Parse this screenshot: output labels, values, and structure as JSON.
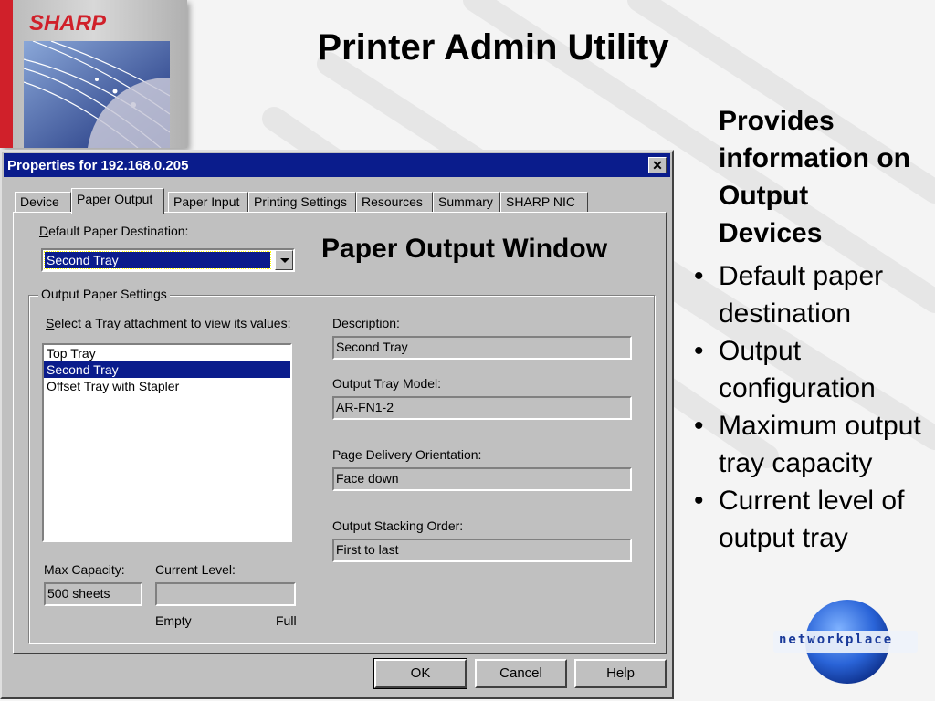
{
  "slide": {
    "title": "Printer Admin Utility",
    "side_heading": "Provides information on Output Devices",
    "bullets": [
      "Default paper destination",
      "Output configuration",
      "Maximum output tray capacity",
      "Current level of output tray"
    ],
    "panel_caption": "Paper Output Window",
    "logo_text": "SHARP",
    "np_logo_text": "networkplace"
  },
  "dialog": {
    "title": "Properties for 192.168.0.205",
    "close_glyph": "✕",
    "tabs": [
      {
        "label": "Device",
        "active": false
      },
      {
        "label": "Paper Output",
        "active": true
      },
      {
        "label": "Paper Input",
        "active": false
      },
      {
        "label": "Printing Settings",
        "active": false
      },
      {
        "label": "Resources",
        "active": false
      },
      {
        "label": "Summary",
        "active": false
      },
      {
        "label": "SHARP NIC",
        "active": false
      }
    ],
    "default_dest_label_pre": "D",
    "default_dest_label_rest": "efault Paper Destination:",
    "default_dest_value": "Second Tray",
    "group_legend": "Output Paper Settings",
    "select_label_pre": "S",
    "select_label_rest": "elect a Tray attachment to view its values:",
    "trays": [
      "Top Tray",
      "Second Tray",
      "Offset Tray with Stapler"
    ],
    "selected_tray": "Second Tray",
    "description_label": "Description:",
    "description_value": "Second Tray",
    "model_label": "Output Tray Model:",
    "model_value": "AR-FN1-2",
    "orientation_label": "Page Delivery Orientation:",
    "orientation_value": "Face down",
    "stacking_label": "Output Stacking Order:",
    "stacking_value": "First to last",
    "max_capacity_label": "Max Capacity:",
    "max_capacity_value": "500 sheets",
    "current_level_label": "Current Level:",
    "current_level_value": "",
    "empty_label": "Empty",
    "full_label": "Full",
    "buttons": {
      "ok": "OK",
      "cancel": "Cancel",
      "help": "Help"
    }
  },
  "colors": {
    "titlebar": "#0a1c8c",
    "dialog_face": "#c0c0c0",
    "sharp_red": "#d0202a"
  }
}
